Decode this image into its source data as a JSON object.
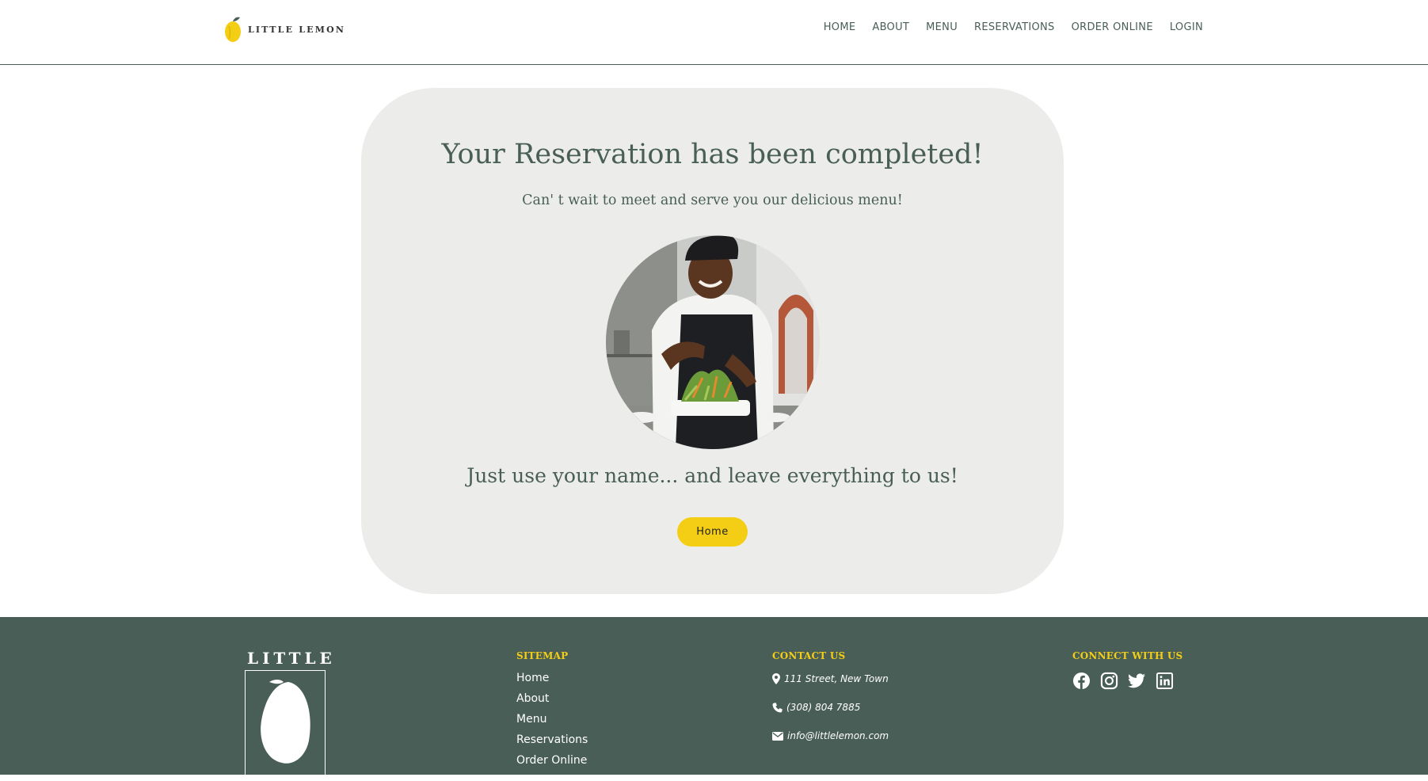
{
  "header": {
    "logo_text": "LITTLE LEMON",
    "nav": [
      {
        "label": "HOME"
      },
      {
        "label": "ABOUT"
      },
      {
        "label": "MENU"
      },
      {
        "label": "RESERVATIONS"
      },
      {
        "label": "ORDER ONLINE"
      },
      {
        "label": "LOGIN"
      }
    ]
  },
  "confirmation": {
    "title": "Your Reservation has been completed!",
    "subtitle": "Can' t wait to meet and serve you our delicious menu!",
    "tagline": "Just use your name... and leave everything to us!",
    "button_label": "Home",
    "image_icon": "chef-plating-photo"
  },
  "footer": {
    "logo_text": "LITTLE",
    "sitemap": {
      "heading": "SITEMAP",
      "links": [
        {
          "label": "Home"
        },
        {
          "label": "About"
        },
        {
          "label": "Menu"
        },
        {
          "label": "Reservations"
        },
        {
          "label": "Order Online"
        }
      ]
    },
    "contact": {
      "heading": "CONTACT US",
      "address": "111 Street, New Town",
      "phone": "(308) 804 7885",
      "email": "info@littlelemon.com"
    },
    "social": {
      "heading": "CONNECT WITH US",
      "icons": [
        "facebook-icon",
        "instagram-icon",
        "twitter-icon",
        "linkedin-icon"
      ]
    }
  },
  "colors": {
    "primary_green": "#495e57",
    "primary_yellow": "#f4ce14",
    "card_background": "#ecedeb"
  }
}
